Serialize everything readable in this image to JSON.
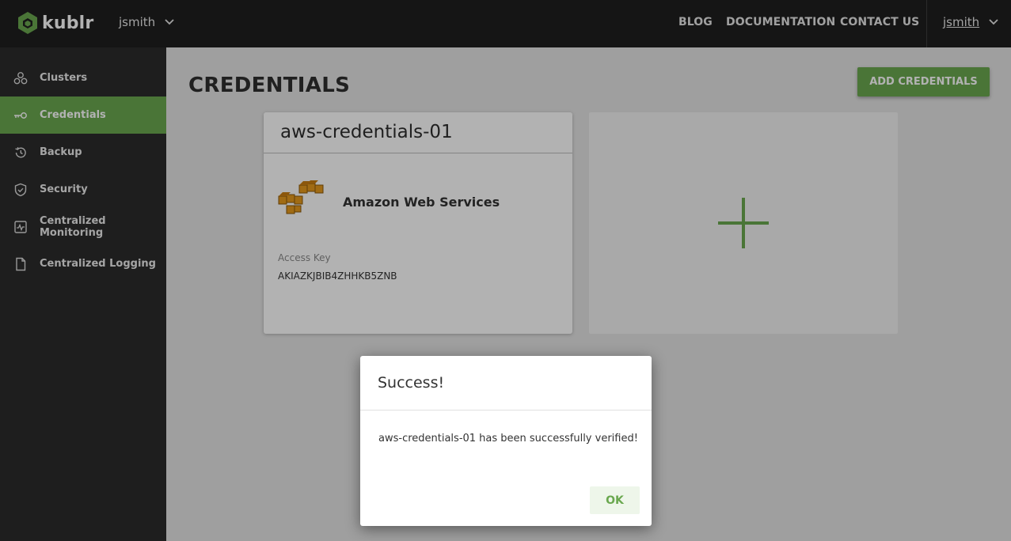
{
  "brand": {
    "name": "kublr",
    "color": "#6aa84f"
  },
  "header": {
    "user_left": "jsmith",
    "nav": {
      "blog": "BLOG",
      "documentation": "DOCUMENTATION",
      "contact": "CONTACT US"
    },
    "user_right": "jsmith"
  },
  "sidebar": {
    "items": [
      {
        "label": "Clusters",
        "icon": "clusters-icon"
      },
      {
        "label": "Credentials",
        "icon": "key-icon",
        "active": true
      },
      {
        "label": "Backup",
        "icon": "backup-icon"
      },
      {
        "label": "Security",
        "icon": "shield-icon"
      },
      {
        "label": "Centralized Monitoring",
        "icon": "monitoring-icon"
      },
      {
        "label": "Centralized Logging",
        "icon": "document-icon"
      }
    ]
  },
  "main": {
    "title": "CREDENTIALS",
    "add_button": "ADD CREDENTIALS",
    "card": {
      "name": "aws-credentials-01",
      "provider": "Amazon Web Services",
      "access_key_label": "Access Key",
      "access_key_value": "AKIAZKJBIB4ZHHKB5ZNB"
    }
  },
  "modal": {
    "title": "Success!",
    "message": "aws-credentials-01 has been successfully verified!",
    "ok_button": "OK"
  }
}
